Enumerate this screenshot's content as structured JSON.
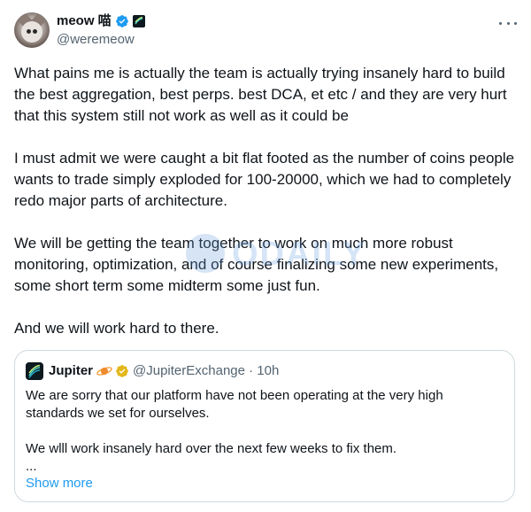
{
  "author": {
    "display_name": "meow 喵",
    "handle": "@weremeow"
  },
  "tweet": {
    "paragraphs": [
      "What pains me is actually the team is actually trying insanely hard to build the best aggregation, best perps. best DCA, et etc / and they are very hurt that this system still not work as well as it could be",
      "I must admit we were caught a bit flat footed as the number of coins people wants to trade simply exploded for 100-20000, which we had to completely redo major parts of architecture.",
      "We will be getting the team together to work on much more robust monitoring, optimization, and of course finalizing some new experiments, some short term some midterm some just fun.",
      "And we will work hard to there."
    ]
  },
  "watermark": {
    "text": "ODAILY"
  },
  "quoted": {
    "display_name": "Jupiter",
    "handle_time": "@JupiterExchange · 10h",
    "paragraphs": [
      "We are sorry that our platform have not been operating at the very high standards we set for ourselves.",
      "We wlll work insanely hard over the next few weeks to fix them.\n..."
    ],
    "show_more_label": "Show more"
  },
  "colors": {
    "link": "#1d9bf0",
    "secondary_text": "#536471",
    "border": "#cfd9de",
    "verified_blue": "#1d9bf0",
    "verified_gold": "#e2b719"
  },
  "icons": {
    "verified": "verified-badge-icon",
    "affiliate": "jupiter-affiliate-icon",
    "more": "more-options-icon"
  }
}
